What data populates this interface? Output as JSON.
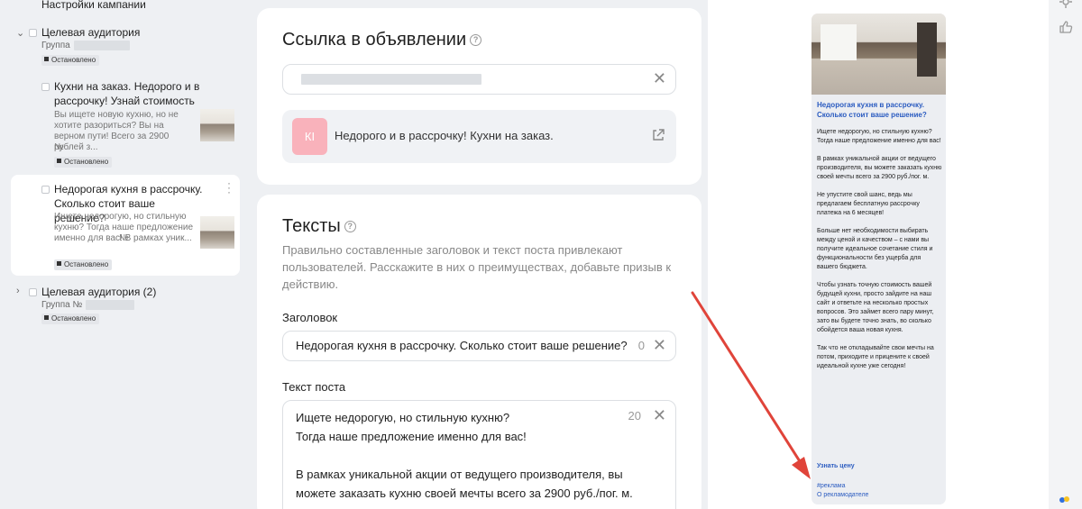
{
  "sidebar": {
    "campaign_settings": "Настройки кампании",
    "group1": {
      "title": "Целевая аудитория",
      "sub": "Группа",
      "status": "Остановлено"
    },
    "ad1": {
      "title": "Кухни на заказ. Недорого и в рассрочку! Узнай стоимость",
      "desc": "Вы ищете новую кухню, но не хотите разориться? Вы на верном пути! Всего за 2900 рублей з...",
      "num": "№",
      "status": "Остановлено"
    },
    "ad2": {
      "title": "Недорогая кухня в рассрочку. Сколько стоит ваше решение?",
      "desc": "Ищете недорогую, но стильную кухню? Тогда наше предложение именно для вас! В рамках уник...",
      "num": "№",
      "status": "Остановлено"
    },
    "group2": {
      "title": "Целевая аудитория (2)",
      "sub": "Группа №",
      "status": "Остановлено"
    }
  },
  "link_card": {
    "title": "Ссылка в объявлении",
    "preview_badge": "КІ",
    "preview_text": "Недорого и в рассрочку! Кухни на заказ."
  },
  "texts_card": {
    "title": "Тексты",
    "hint": "Правильно составленные заголовок и текст поста привлекают пользователей. Расскажите в них о преимуществах, добавьте призыв к действию.",
    "headline_label": "Заголовок",
    "headline_value": "Недорогая кухня в рассрочку. Сколько стоит ваше решение?",
    "headline_count": "0",
    "post_label": "Текст поста",
    "post_count": "20",
    "post_line1": "Ищете недорогую, но стильную кухню?",
    "post_line2": "Тогда наше предложение именно для вас!",
    "post_line3": "В рамках уникальной акции от ведущего производителя, вы можете заказать кухню своей мечты всего за 2900 руб./пог. м."
  },
  "phone_preview": {
    "title": "Недорогая кухня в рассрочку. Сколько стоит ваше решение?",
    "body": "Ищете недорогую, но стильную кухню?\nТогда наше предложение именно для вас!\n\nВ рамках уникальной акции от ведущего производителя, вы можете заказать кухню своей мечты всего за 2900 руб./пог. м.\n\nНе упустите свой шанс, ведь мы предлагаем бесплатную рассрочку платежа на 6 месяцев!\n\nБольше нет необходимости выбирать между ценой и качеством – с нами вы получите идеальное сочетание стиля и функциональности без ущерба для вашего бюджета.\n\nЧтобы узнать точную стоимость вашей будущей кухни, просто зайдите на наш сайт и ответьте на несколько простых вопросов. Это займет всего пару минут, зато вы будете точно знать, во сколько обойдется ваша новая кухня.\n\nТак что не откладывайте свои мечты на потом, приходите и прицените к своей идеальной кухне уже сегодня!",
    "cta": "Узнать цену",
    "hashtag": "#реклама",
    "advertiser": "О рекламодателе"
  },
  "colors": {
    "accent_link": "#2a5bc0",
    "arrow": "#e0443a",
    "badge_pink": "#f9b2bb"
  },
  "icons": [
    "chevron-down-icon",
    "chevron-right-icon",
    "question-icon",
    "close-icon",
    "external-link-icon",
    "settings-icon",
    "thumbs-up-icon"
  ]
}
